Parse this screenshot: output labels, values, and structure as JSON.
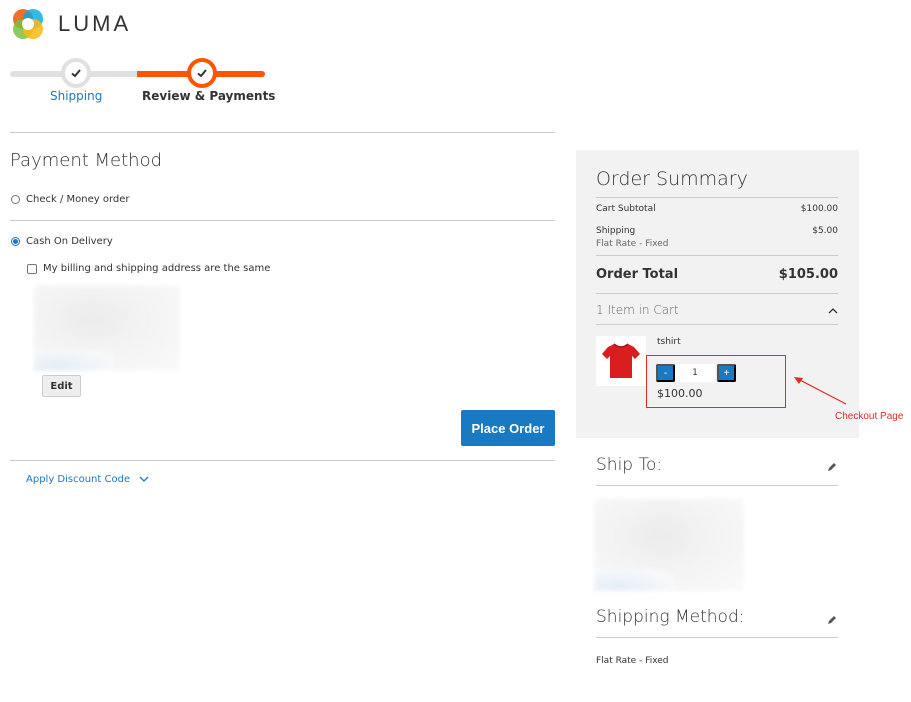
{
  "brand": {
    "name": "LUMA"
  },
  "progress": {
    "steps": [
      {
        "label": "Shipping",
        "state": "complete"
      },
      {
        "label": "Review & Payments",
        "state": "active"
      }
    ]
  },
  "payment": {
    "title": "Payment Method",
    "options": [
      {
        "label": "Check / Money order",
        "selected": false
      },
      {
        "label": "Cash On Delivery",
        "selected": true
      }
    ],
    "same_address_label": "My billing and shipping address are the same",
    "edit_label": "Edit",
    "place_order_label": "Place Order",
    "discount_label": "Apply Discount Code"
  },
  "summary": {
    "title": "Order Summary",
    "cart_subtotal_label": "Cart Subtotal",
    "cart_subtotal_value": "$100.00",
    "shipping_label": "Shipping",
    "shipping_sub": "Flat Rate - Fixed",
    "shipping_value": "$5.00",
    "order_total_label": "Order Total",
    "order_total_value": "$105.00",
    "items_label": "1 Item in Cart",
    "item": {
      "name": "tshirt",
      "qty": "1",
      "minus": "-",
      "plus": "+",
      "price": "$100.00"
    }
  },
  "annotation": {
    "text": "Checkout Page"
  },
  "ship_to": {
    "title": "Ship To:"
  },
  "shipping_method": {
    "title": "Shipping Method:",
    "value": "Flat Rate - Fixed"
  },
  "colors": {
    "accent": "#1979c3",
    "progress_active": "#ff5501",
    "annotation": "#e02b27"
  },
  "icons": [
    "luma-logo-icon",
    "check-icon",
    "chevron-down-icon",
    "chevron-up-icon",
    "tshirt-icon",
    "pencil-icon",
    "arrow-icon"
  ]
}
